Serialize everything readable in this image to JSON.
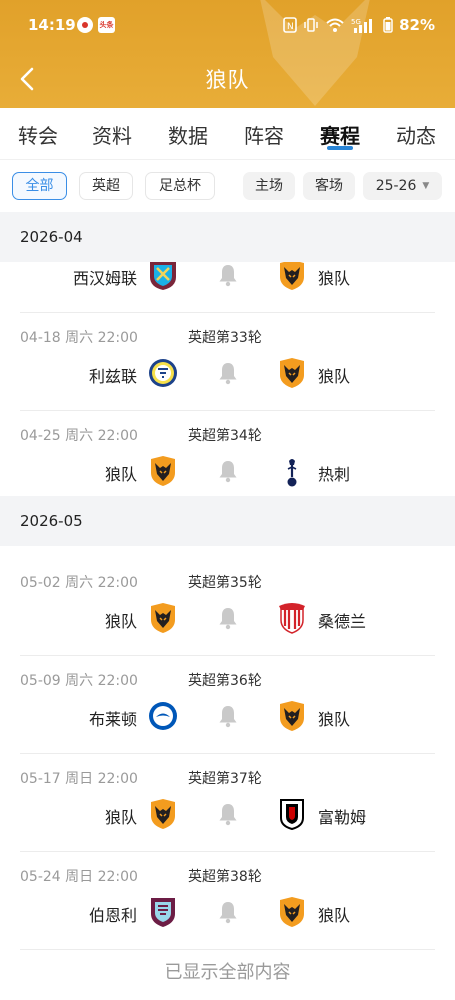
{
  "status_bar": {
    "time": "14:19",
    "app_badge": "头条",
    "battery": "82%",
    "network": "5G"
  },
  "nav": {
    "title": "狼队",
    "back_icon": "chevron-left-icon"
  },
  "tabs": [
    {
      "label": "转会"
    },
    {
      "label": "资料"
    },
    {
      "label": "数据"
    },
    {
      "label": "阵容"
    },
    {
      "label": "赛程",
      "active": true
    },
    {
      "label": "动态"
    }
  ],
  "filters": {
    "all": "全部",
    "premier": "英超",
    "facup": "足总杯",
    "home": "主场",
    "away": "客场",
    "season": "25-26"
  },
  "months": [
    {
      "label": "2026-04"
    },
    {
      "label": "2026-05"
    }
  ],
  "matches": [
    {
      "date": "",
      "round": "",
      "home": "西汉姆联",
      "home_crest": "west-ham-crest",
      "away": "狼队",
      "away_crest": "wolves-crest"
    },
    {
      "date": "04-18 周六 22:00",
      "round": "英超第33轮",
      "home": "利兹联",
      "home_crest": "leeds-crest",
      "away": "狼队",
      "away_crest": "wolves-crest"
    },
    {
      "date": "04-25 周六 22:00",
      "round": "英超第34轮",
      "home": "狼队",
      "home_crest": "wolves-crest",
      "away": "热刺",
      "away_crest": "tottenham-crest"
    },
    {
      "date": "05-02 周六 22:00",
      "round": "英超第35轮",
      "home": "狼队",
      "home_crest": "wolves-crest",
      "away": "桑德兰",
      "away_crest": "sunderland-crest"
    },
    {
      "date": "05-09 周六 22:00",
      "round": "英超第36轮",
      "home": "布莱顿",
      "home_crest": "brighton-crest",
      "away": "狼队",
      "away_crest": "wolves-crest"
    },
    {
      "date": "05-17 周日 22:00",
      "round": "英超第37轮",
      "home": "狼队",
      "home_crest": "wolves-crest",
      "away": "富勒姆",
      "away_crest": "fulham-crest"
    },
    {
      "date": "05-24 周日 22:00",
      "round": "英超第38轮",
      "home": "伯恩利",
      "home_crest": "burnley-crest",
      "away": "狼队",
      "away_crest": "wolves-crest"
    }
  ],
  "footer": "已显示全部内容",
  "colors": {
    "header": "#e1a12a",
    "accent": "#2a86d8",
    "wolves": "#f39c1f"
  }
}
